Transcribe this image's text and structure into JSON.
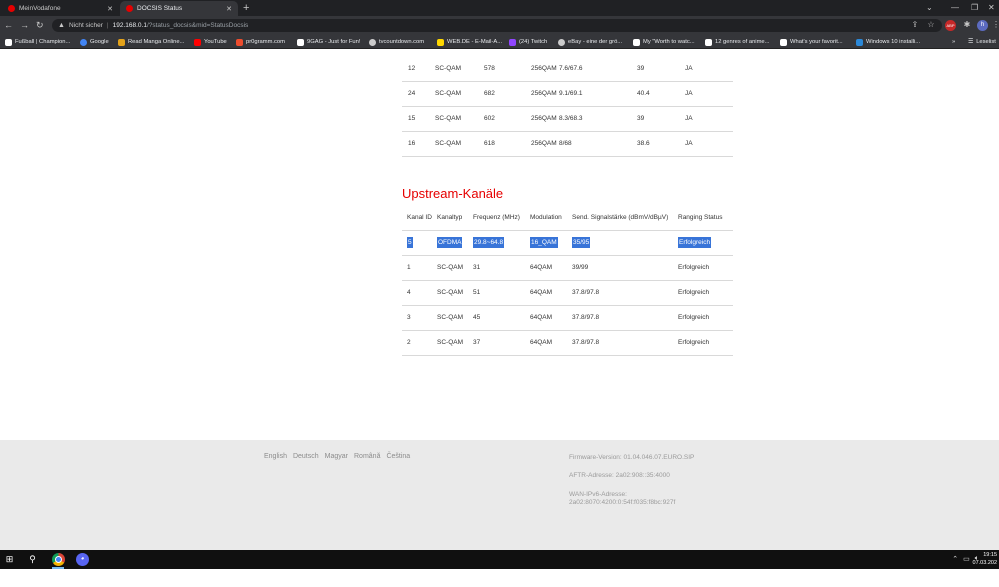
{
  "browser": {
    "tabs": [
      {
        "title": "MeinVodafone",
        "active": false
      },
      {
        "title": "DOCSIS Status",
        "active": true
      }
    ],
    "address": {
      "security_label": "Nicht sicher",
      "url_host": "192.168.0.1",
      "url_path": "/?status_docsis&mid=StatusDocsis"
    },
    "profile_initial": "h",
    "extension_badge": "ABP",
    "bookmarks": [
      {
        "label": "Fußball | Champion...",
        "color": "#ffffff"
      },
      {
        "label": "Google",
        "color": "#4285f4"
      },
      {
        "label": "Read Manga Online...",
        "color": "#e3a21a"
      },
      {
        "label": "YouTube",
        "color": "#ff0000"
      },
      {
        "label": "pr0gramm.com",
        "color": "#ee4d2e"
      },
      {
        "label": "9GAG - Just for Fun!",
        "color": "#ffffff"
      },
      {
        "label": "tvcountdown.com",
        "color": "#cccccc"
      },
      {
        "label": "WEB.DE - E-Mail-A...",
        "color": "#ffd800"
      },
      {
        "label": "(24) Twitch",
        "color": "#9146ff"
      },
      {
        "label": "eBay - eine der grö...",
        "color": "#cccccc"
      },
      {
        "label": "My \"Worth to watc...",
        "color": "#ffffff"
      },
      {
        "label": "12 genres of anime...",
        "color": "#ffffff"
      },
      {
        "label": "What's your favorit...",
        "color": "#ffffff"
      },
      {
        "label": "Windows 10 installi...",
        "color": "#2b88d8"
      }
    ],
    "reading_list": "Leselist"
  },
  "downstream": {
    "rows": [
      [
        "12",
        "SC-QAM",
        "578",
        "256QAM",
        "7.6/67.6",
        "39",
        "JA"
      ],
      [
        "24",
        "SC-QAM",
        "682",
        "256QAM",
        "9.1/69.1",
        "40.4",
        "JA"
      ],
      [
        "15",
        "SC-QAM",
        "602",
        "256QAM",
        "8.3/68.3",
        "39",
        "JA"
      ],
      [
        "16",
        "SC-QAM",
        "618",
        "256QAM",
        "8/68",
        "38.6",
        "JA"
      ]
    ]
  },
  "upstream": {
    "title": "Upstream-Kanäle",
    "headers": [
      "Kanal ID",
      "Kanaltyp",
      "Frequenz (MHz)",
      "Modulation",
      "Send. Signalstärke (dBmV/dBµV)",
      "Ranging Status"
    ],
    "rows": [
      [
        "5",
        "OFDMA",
        "29.8~64.8",
        "16_QAM",
        "35/95",
        "Erfolgreich"
      ],
      [
        "1",
        "SC-QAM",
        "31",
        "64QAM",
        "39/99",
        "Erfolgreich"
      ],
      [
        "4",
        "SC-QAM",
        "51",
        "64QAM",
        "37.8/97.8",
        "Erfolgreich"
      ],
      [
        "3",
        "SC-QAM",
        "45",
        "64QAM",
        "37.8/97.8",
        "Erfolgreich"
      ],
      [
        "2",
        "SC-QAM",
        "37",
        "64QAM",
        "37.8/97.8",
        "Erfolgreich"
      ]
    ]
  },
  "footer": {
    "languages": [
      "English",
      "Deutsch",
      "Magyar",
      "Română",
      "Čeština"
    ],
    "firmware": "Firmware-Version: 01.04.046.07.EURO.SIP",
    "aftr": "AFTR-Adresse: 2a02:908::35:4000",
    "wan_label": "WAN-IPv6-Adresse:",
    "wan_value": "2a02:8070:4200:0:54f:f035:f8bc:927f"
  },
  "taskbar": {
    "time": "19:15",
    "date": "07.03.202"
  }
}
